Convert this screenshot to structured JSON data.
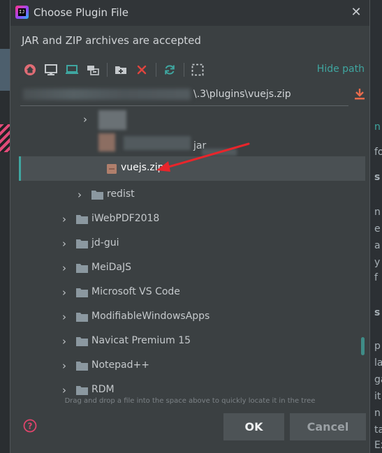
{
  "dialog": {
    "title": "Choose Plugin File",
    "subtitle": "JAR and ZIP archives are accepted",
    "hide_path_label": "Hide path",
    "path_visible_suffix": "\\.3\\plugins\\vuejs.zip",
    "drag_hint": "Drag and drop a file into the space above to quickly locate it in the tree",
    "ok_label": "OK",
    "cancel_label": "Cancel"
  },
  "toolbar": {
    "icons": [
      "home-icon",
      "desktop-icon",
      "laptop-icon",
      "tree-icon",
      "new-folder-icon",
      "delete-icon",
      "refresh-icon",
      "select-frame-icon"
    ]
  },
  "tree": {
    "partial_file_suffix": "jar",
    "selected_file": "vuejs.zip",
    "folders": [
      {
        "label": "redist",
        "indent": "deep"
      },
      {
        "label": "iWebPDF2018"
      },
      {
        "label": "jd-gui"
      },
      {
        "label": "MeiDaJS"
      },
      {
        "label": "Microsoft VS Code"
      },
      {
        "label": "ModifiableWindowsApps"
      },
      {
        "label": "Navicat Premium 15"
      },
      {
        "label": "Notepad++"
      },
      {
        "label": "RDM"
      }
    ]
  },
  "background": {
    "right_fragments": [
      "n",
      "fo",
      "s",
      "n",
      "e",
      "a",
      "y",
      "f",
      "s",
      "p",
      "la",
      "ga",
      "it",
      "n",
      "ta",
      "Extra"
    ]
  },
  "colors": {
    "accent": "#3fa6a0",
    "dialog_bg": "#3b4042",
    "annotation_arrow": "#e8252b",
    "home_icon": "#e06c75",
    "delete_icon": "#e0443e",
    "download_icon": "#e86b4c"
  }
}
